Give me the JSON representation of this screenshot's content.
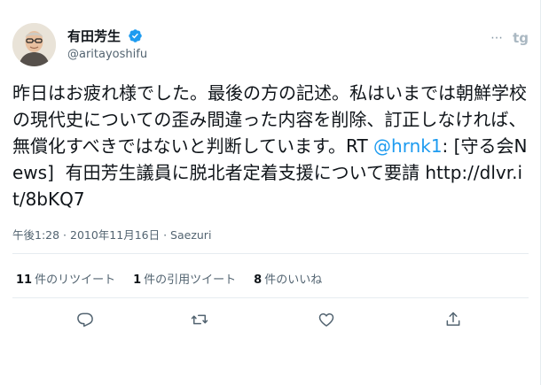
{
  "user": {
    "display_name": "有田芳生",
    "handle": "@aritayoshifu",
    "verified": true
  },
  "header": {
    "more_icon": "⋯",
    "client_icon": "tg"
  },
  "tweet": {
    "text_part1": "昨日はお疲れ様でした。最後の方の記述。私はいまでは朝鮮学校の現代史についての歪み間違った内容を削除、訂正しなければ、無償化すべきではないと判断しています。RT ",
    "mention": "@hrnk1",
    "text_part2": ": [守る会News]  有田芳生議員に脱北者定着支援について要請 http://dlvr.it/8bKQ7"
  },
  "meta": {
    "time": "午後1:28 · 2010年11月16日 · Saezuri"
  },
  "stats": {
    "retweets_count": "11",
    "retweets_label": "件のリツイート",
    "quotes_count": "1",
    "quotes_label": "件の引用ツイート",
    "likes_count": "8",
    "likes_label": "件のいいね"
  },
  "colors": {
    "accent": "#1d9bf0",
    "muted": "#536471",
    "divider": "#e6ecf0"
  }
}
